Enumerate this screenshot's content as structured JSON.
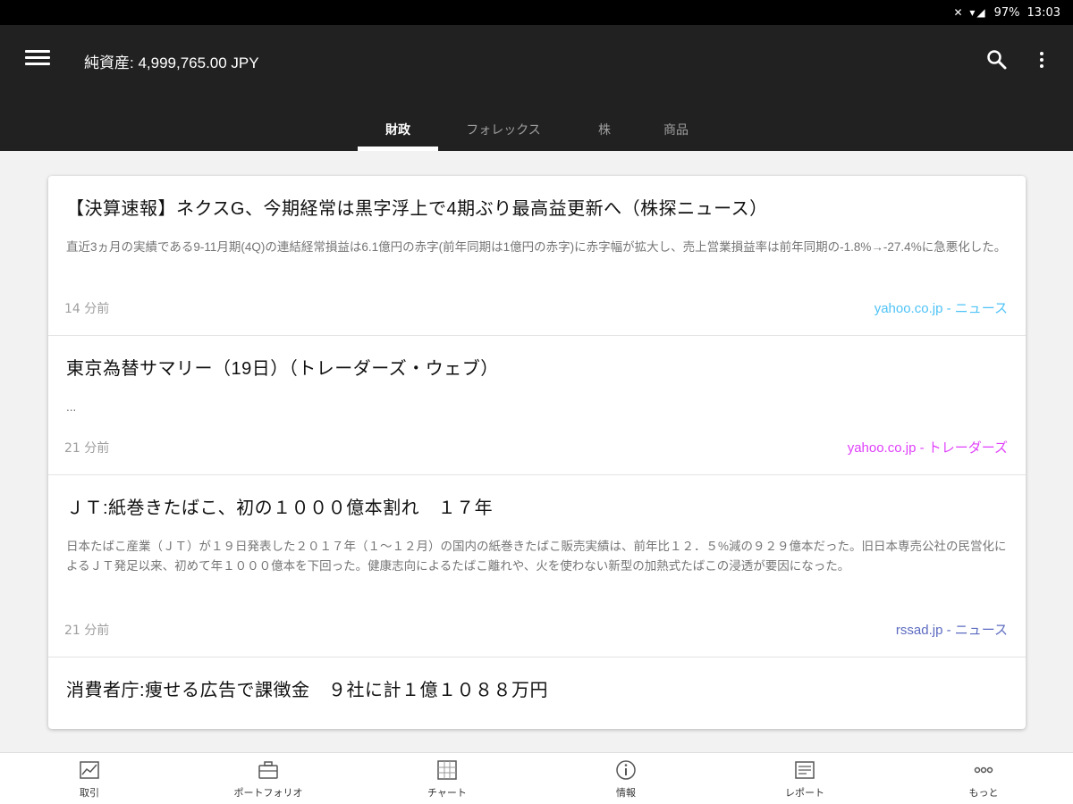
{
  "status_bar": {
    "battery": "97%",
    "time": "13:03"
  },
  "app_bar": {
    "title": "純資産: 4,999,765.00 JPY"
  },
  "tabs": [
    {
      "label": "財政",
      "active": true
    },
    {
      "label": "フォレックス",
      "active": false
    },
    {
      "label": "株",
      "active": false
    },
    {
      "label": "商品",
      "active": false
    }
  ],
  "news": [
    {
      "headline": "【決算速報】ネクスG、今期経常は黒字浮上で4期ぶり最高益更新へ（株探ニュース）",
      "summary": "直近3ヵ月の実績である9-11月期(4Q)の連結経常損益は6.1億円の赤字(前年同期は1億円の赤字)に赤字幅が拡大し、売上営業損益率は前年同期の-1.8%→-27.4%に急悪化した。",
      "time": "14 分前",
      "source": "yahoo.co.jp - ニュース",
      "source_color": "#4fc3f7"
    },
    {
      "headline": "東京為替サマリー（19日）（トレーダーズ・ウェブ）",
      "summary": "...",
      "time": "21 分前",
      "source": "yahoo.co.jp - トレーダーズ",
      "source_color": "#e040fb"
    },
    {
      "headline": "ＪＴ:紙巻きたばこ、初の１０００億本割れ　１７年",
      "summary": "日本たばこ産業（ＪＴ）が１９日発表した２０１７年（１～１２月）の国内の紙巻きたばこ販売実績は、前年比１２．５%減の９２９億本だった。旧日本専売公社の民営化によるＪＴ発足以来、初めて年１０００億本を下回った。健康志向によるたばこ離れや、火を使わない新型の加熱式たばこの浸透が要因になった。",
      "time": "21 分前",
      "source": "rssad.jp - ニュース",
      "source_color": "#5c6bc0"
    },
    {
      "headline": "消費者庁:痩せる広告で課徴金　９社に計１億１０８８万円",
      "summary": "",
      "time": "",
      "source": "",
      "source_color": "#9e9e9e"
    }
  ],
  "bottom_nav": [
    {
      "label": "取引",
      "icon": "trade-chart-icon"
    },
    {
      "label": "ポートフォリオ",
      "icon": "briefcase-icon"
    },
    {
      "label": "チャート",
      "icon": "chart-grid-icon"
    },
    {
      "label": "情報",
      "icon": "info-icon"
    },
    {
      "label": "レポート",
      "icon": "report-icon"
    },
    {
      "label": "もっと",
      "icon": "more-dots-icon"
    }
  ]
}
